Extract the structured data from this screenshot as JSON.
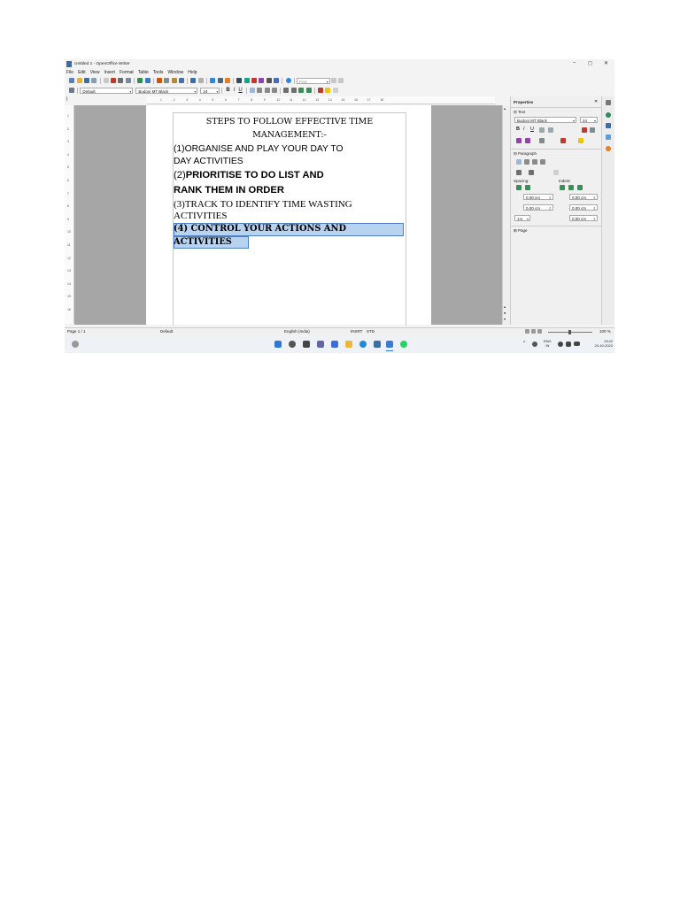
{
  "window": {
    "title": "Untitled 1 - OpenOffice Writer",
    "controls": [
      "–",
      "◻",
      "✕"
    ]
  },
  "menu": [
    "File",
    "Edit",
    "View",
    "Insert",
    "Format",
    "Table",
    "Tools",
    "Window",
    "Help"
  ],
  "toolbar": {
    "find_placeholder": "Find",
    "paragraph_style": "Default",
    "font_name": "Bodoni MT Black",
    "font_size": "24"
  },
  "ruler": {
    "marks": [
      "1",
      "2",
      "3",
      "4",
      "5",
      "6",
      "7",
      "8",
      "9",
      "10",
      "11",
      "12",
      "13",
      "14",
      "15",
      "16",
      "17",
      "18"
    ],
    "vmarks": [
      "1",
      "2",
      "3",
      "4",
      "5",
      "6",
      "7",
      "8",
      "9",
      "10",
      "11",
      "12",
      "13",
      "14",
      "15",
      "16"
    ]
  },
  "document": {
    "title_line1": "STEPS TO FOLLOW EFFECTIVE TIME",
    "title_line2": "MANAGEMENT:-",
    "item1_line1": "(1)ORGANISE AND PLAY YOUR DAY TO",
    "item1_line2": "DAY ACTIVITIES",
    "item2_prefix": "(2)",
    "item2_line1_rest": "PRIORITISE TO DO LIST AND",
    "item2_line2": "RANK THEM IN ORDER",
    "item3_line1": "(3)TRACK TO IDENTIFY TIME WASTING",
    "item3_line2": "ACTIVITIES",
    "item4_prefix": "(4) ",
    "item4_line1_rest": "CONTROL YOUR ACTIONS AND",
    "item4_line2": "ACTIVITIES"
  },
  "sidebar": {
    "title": "Properties",
    "text_section": "Text",
    "font_name": "Bodoni MT Black",
    "font_size": "24",
    "paragraph_section": "Paragraph",
    "spacing_label": "Spacing:",
    "indent_label": "Indent:",
    "spacing_above": "0.00 cm",
    "spacing_below": "0.00 cm",
    "indent_before": "0.00 cm",
    "indent_after": "0.00 cm",
    "first_line": "0.00 cm",
    "line_spacing": "1⅓",
    "page_section": "Page"
  },
  "status": {
    "page": "Page 1 / 1",
    "style": "Default",
    "language": "English (India)",
    "mode": "INSRT",
    "selection": "STD",
    "zoom": "100 %"
  },
  "taskbar": {
    "lang_line1": "ENG",
    "lang_line2": "IN",
    "time": "13:42",
    "date": "24-10-2023"
  },
  "colors": {
    "selection": "#b8d3f0",
    "taskbar_bg": "#eef1f6",
    "doc_bg": "#a6a6a6"
  }
}
